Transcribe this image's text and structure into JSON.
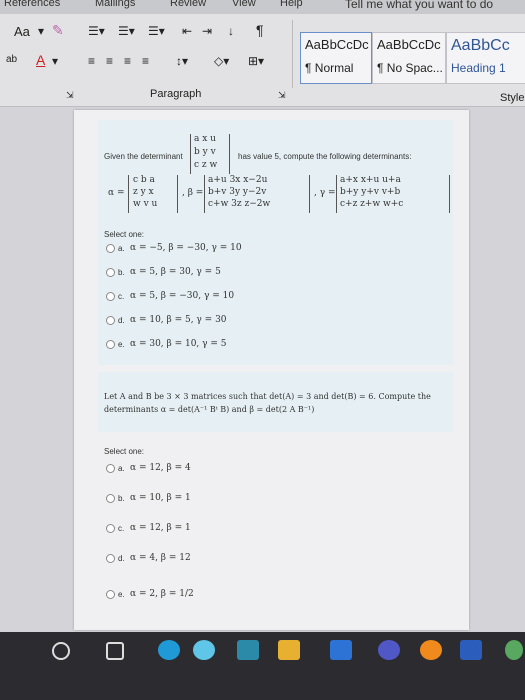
{
  "tabs": [
    "References",
    "Mailings",
    "Review",
    "View",
    "Help",
    "Tell me what you want to do"
  ],
  "ribbon": {
    "font_size_label": "Aa",
    "paragraph_label": "Paragraph",
    "styles_label": "Style",
    "styles": [
      {
        "preview": "AaBbCcDc",
        "name": "¶ Normal"
      },
      {
        "preview": "AaBbCcDc",
        "name": "¶ No Spac..."
      },
      {
        "preview": "AaBbCc",
        "name": "Heading 1"
      }
    ]
  },
  "question1": {
    "intro": "Given the determinant",
    "intro_tail": "has value 5, compute the following determinants:",
    "given_matrix": [
      "a  x  u",
      "b  y  v",
      "c  z  w"
    ],
    "alpha_matrix": [
      "c  b  a",
      "z  y  x",
      "w  v  u"
    ],
    "beta_matrix": [
      "a+u   3x   x−2u",
      "b+v   3y   y−2v",
      "c+w   3z   z−2w"
    ],
    "gamma_matrix": [
      "a+x   x+u   u+a",
      "b+y   y+v   v+b",
      "c+z   z+w   w+c"
    ],
    "select_one": "Select one:",
    "options": [
      {
        "letter": "a.",
        "text": "α = −5,   β = −30,   γ = 10"
      },
      {
        "letter": "b.",
        "text": "α = 5,   β = 30,   γ = 5"
      },
      {
        "letter": "c.",
        "text": "α = 5,   β = −30,   γ = 10"
      },
      {
        "letter": "d.",
        "text": "α = 10,   β = 5,   γ = 30"
      },
      {
        "letter": "e.",
        "text": "α = 30,   β = 10,   γ = 5"
      }
    ]
  },
  "question2": {
    "line1": "Let A and B be 3 × 3 matrices such that det(A) = 3 and det(B) = 6. Compute the",
    "line2": "determinants α = det(A⁻¹ Bᵗ B) and β = det(2 A B⁻¹)",
    "select_one": "Select one:",
    "options": [
      {
        "letter": "a.",
        "text": "α = 12,       β = 4"
      },
      {
        "letter": "b.",
        "text": "α = 10,       β = 1"
      },
      {
        "letter": "c.",
        "text": "α = 12,       β = 1"
      },
      {
        "letter": "d.",
        "text": "α = 4,         β = 12"
      },
      {
        "letter": "e.",
        "text": "α = 2,         β = 1/2"
      }
    ]
  },
  "taskbar": [
    "search-icon",
    "task-view-icon",
    "edge-icon",
    "lens-icon",
    "store-icon",
    "mail-icon",
    "meet-icon",
    "firefox-icon",
    "word-icon"
  ]
}
